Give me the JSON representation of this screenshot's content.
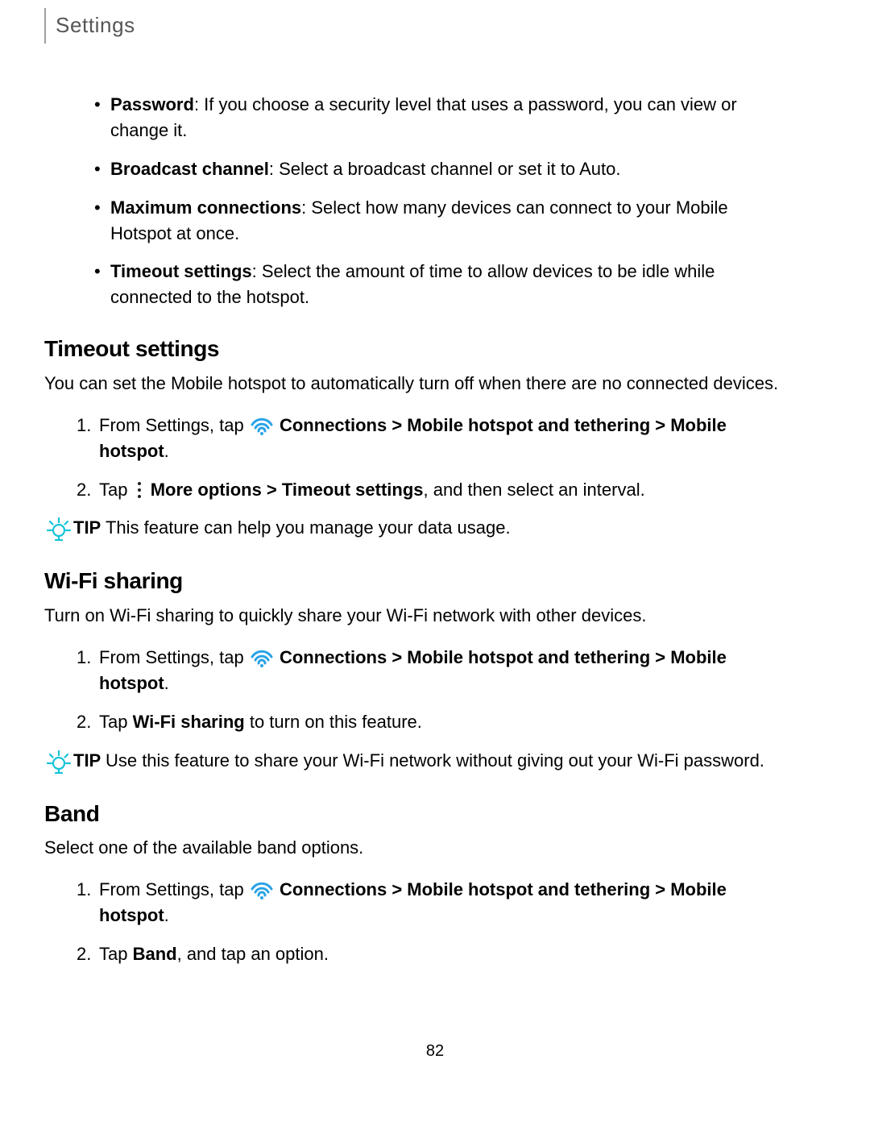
{
  "header": "Settings",
  "bullets": [
    {
      "term": "Password",
      "desc": ": If you choose a security level that uses a password, you can view or change it."
    },
    {
      "term": "Broadcast channel",
      "desc": ": Select a broadcast channel or set it to Auto."
    },
    {
      "term": "Maximum connections",
      "desc": ": Select how many devices can connect to your Mobile Hotspot at once."
    },
    {
      "term": "Timeout settings",
      "desc": ": Select the amount of time to allow devices to be idle while connected to the hotspot."
    }
  ],
  "sections": [
    {
      "title": "Timeout settings",
      "para": "You can set the Mobile hotspot to automatically turn off when there are no connected devices.",
      "steps": [
        {
          "preWifi": "From Settings, tap ",
          "afterWifiBold": "Connections > Mobile hotspot and tethering > Mobile hotspot",
          "tail": "."
        },
        {
          "pre": "Tap ",
          "hasMoreIcon": true,
          "bold1": "More options > Timeout settings",
          "tail2": ", and then select an interval."
        }
      ],
      "tip": {
        "label": "TIP ",
        "text": "This feature can help you manage your data usage."
      }
    },
    {
      "title": "Wi-Fi sharing",
      "para": "Turn on Wi-Fi sharing to quickly share your Wi-Fi network with other devices.",
      "steps": [
        {
          "preWifi": "From Settings, tap ",
          "afterWifiBold": "Connections > Mobile hotspot and tethering > Mobile hotspot",
          "tail": "."
        },
        {
          "pre": "Tap ",
          "bold1": "Wi-Fi sharing",
          "tail2": " to turn on this feature."
        }
      ],
      "tip": {
        "label": "TIP ",
        "text": "Use this feature to share your Wi-Fi network without giving out your Wi-Fi password."
      }
    },
    {
      "title": "Band",
      "para": "Select one of the available band options.",
      "steps": [
        {
          "preWifi": "From Settings, tap ",
          "afterWifiBold": "Connections > Mobile hotspot and tethering > Mobile hotspot",
          "tail": "."
        },
        {
          "pre": "Tap ",
          "bold1": "Band",
          "tail2": ", and tap an option."
        }
      ]
    }
  ],
  "pagenum": "82"
}
